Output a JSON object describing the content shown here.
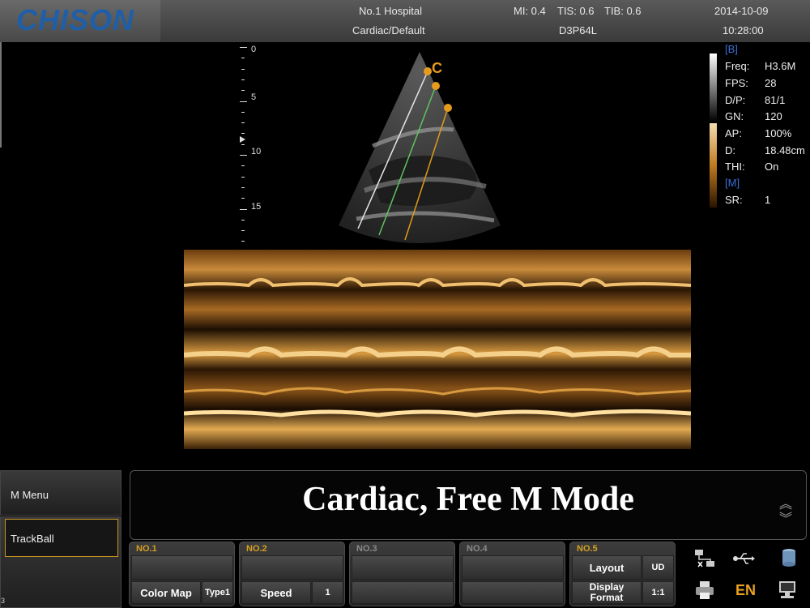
{
  "header": {
    "logo": "CHISON",
    "hospital": "No.1 Hospital",
    "preset": "Cardiac/Default",
    "mi": "MI:  0.4",
    "tis": "TIS:  0.6",
    "tib": "TIB:  0.6",
    "probe": "D3P64L",
    "date": "2014-10-09",
    "time": "10:28:00"
  },
  "scale": {
    "labels": [
      "0",
      "5",
      "10",
      "15"
    ]
  },
  "sector": {
    "cursor_label": "C"
  },
  "info": {
    "b_label": "[B]",
    "m_label": "[M]",
    "rows": [
      {
        "k": "Freq:",
        "v": "H3.6M"
      },
      {
        "k": "FPS:",
        "v": "28"
      },
      {
        "k": "D/P:",
        "v": "81/1"
      },
      {
        "k": "GN:",
        "v": "120"
      },
      {
        "k": "AP:",
        "v": "100%"
      },
      {
        "k": "D:",
        "v": "18.48cm"
      },
      {
        "k": "THI:",
        "v": "On"
      }
    ],
    "sr": {
      "k": "SR:",
      "v": "1"
    }
  },
  "side": {
    "menu": "M Menu",
    "trackball": "TrackBall",
    "corner": "3"
  },
  "message": "Cardiac, Free M Mode",
  "cards": [
    {
      "title": "NO.1",
      "label": "Color Map",
      "value": "Type1"
    },
    {
      "title": "NO.2",
      "label": "Speed",
      "value": "1"
    },
    {
      "title": "NO.3"
    },
    {
      "title": "NO.4"
    },
    {
      "title": "NO.5",
      "label": "Layout",
      "value": "UD",
      "label2": "Display Format",
      "value2": "1:1"
    }
  ],
  "status": {
    "lang": "EN"
  },
  "colors": {
    "accent": "#d4a020",
    "logo": "#1e5fa8",
    "info_blue": "#3b6fd8"
  }
}
